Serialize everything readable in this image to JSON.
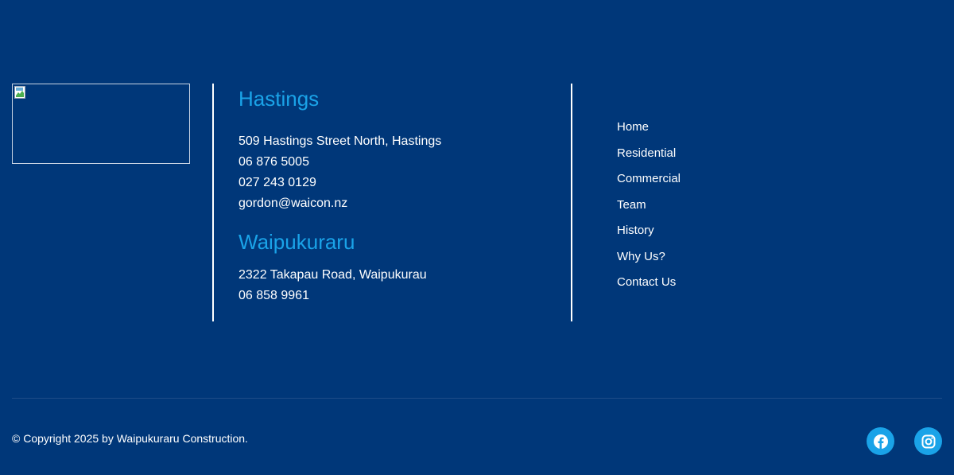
{
  "logo": {
    "alt": "",
    "icon": "broken-image-icon"
  },
  "locations": [
    {
      "title": "Hastings",
      "lines": [
        "509 Hastings Street North, Hastings",
        "06 876 5005",
        "027 243 0129",
        "gordon@waicon.nz"
      ]
    },
    {
      "title": "Waipukuraru",
      "lines": [
        "2322 Takapau Road, Waipukurau",
        "06 858 9961"
      ]
    }
  ],
  "nav": {
    "items": [
      "Home",
      "Residential",
      "Commercial",
      "Team",
      "History",
      "Why Us?",
      "Contact Us"
    ]
  },
  "footer": {
    "copyright": "© Copyright 2025 by Waipukuraru Construction."
  },
  "social": [
    {
      "name": "facebook",
      "icon": "facebook-icon"
    },
    {
      "name": "instagram",
      "icon": "instagram-icon"
    }
  ],
  "colors": {
    "background": "#003779",
    "accent": "#1aa3e8",
    "text": "#ffffff"
  }
}
